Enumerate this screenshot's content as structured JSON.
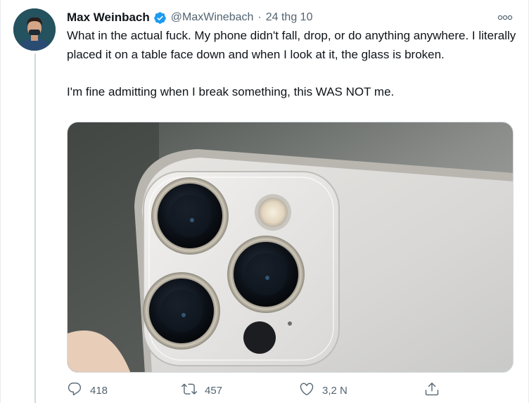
{
  "author": {
    "name": "Max Weinbach",
    "handle": "@MaxWinebach",
    "date": "24 thg 10",
    "separator": "·",
    "verified": true
  },
  "tweet": {
    "paragraph_1": "What in the actual fuck. My phone didn't fall, drop, or do anything anywhere. I literally placed it on a table face down and when I look at it, the glass is broken.",
    "paragraph_2": "I'm fine admitting when I break something, this WAS NOT me."
  },
  "actions": {
    "reply_count": "418",
    "retweet_count": "457",
    "like_count": "3,2 N"
  },
  "colors": {
    "accent": "#1d9bf0",
    "text": "#0f1419",
    "secondary": "#536471",
    "divider": "#e6ecf0"
  },
  "icons": {
    "verified": "verified-badge-icon",
    "more": "more-options-icon",
    "reply": "reply-icon",
    "retweet": "retweet-icon",
    "like": "heart-icon",
    "share": "share-icon"
  }
}
